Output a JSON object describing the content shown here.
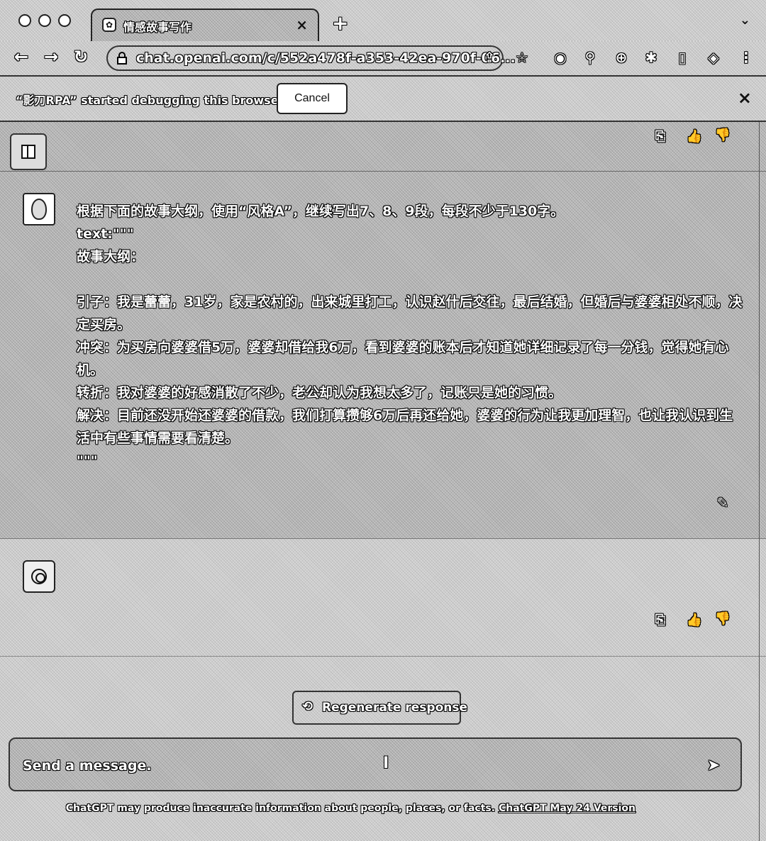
{
  "browser": {
    "tab_title": "情感故事写作",
    "tab_close": "×",
    "new_tab": "+",
    "tab_menu": "⌄",
    "back": "←",
    "forward": "→",
    "reload": "↻",
    "url": "chat.openai.com/c/552a478f-a353-42ea-970f-06...",
    "toolbar_icons": [
      "⇪",
      "☆",
      "◉",
      "⚲",
      "⊕",
      "✱",
      "▯",
      "◈",
      "⋮"
    ]
  },
  "infobar": {
    "message": "“影刀RPA” started debugging this browser",
    "cancel_label": "Cancel",
    "close": "×"
  },
  "chat": {
    "top_actions": [
      "⎘",
      "👍",
      "👎"
    ],
    "user_message": {
      "lines": [
        "根据下面的故事大纲，使用“风格A”，继续写出7、8、9段，每段不少于130字。",
        "text:\"\"\"",
        "故事大纲：",
        "",
        "引子：我是蕾蕾，31岁，家是农村的，出来城里打工，认识赵什后交往，最后结婚，但婚后与婆婆相处不顺，决定买房。",
        "冲突：为买房向婆婆借5万，婆婆却借给我6万，看到婆婆的账本后才知道她详细记录了每一分钱，觉得她有心机。",
        "转折：我对婆婆的好感消散了不少，老公却认为我想太多了，记账只是她的习惯。",
        "解决：目前还没开始还婆婆的借款，我们打算攒够6万后再还给她，婆婆的行为让我更加理智，也让我认识到生活中有些事情需要看清楚。",
        "\"\"\""
      ],
      "edit_icon": "✎"
    },
    "assistant_actions": [
      "⎘",
      "👍",
      "👎"
    ]
  },
  "composer": {
    "regenerate_icon": "⟲",
    "regenerate_label": "Regenerate response",
    "placeholder": "Send a message.",
    "send_icon": "➤",
    "cursor_icon": "I"
  },
  "footer": {
    "disclaimer": "ChatGPT may produce inaccurate information about people, places, or facts. ",
    "version_link": "ChatGPT May 24 Version"
  }
}
